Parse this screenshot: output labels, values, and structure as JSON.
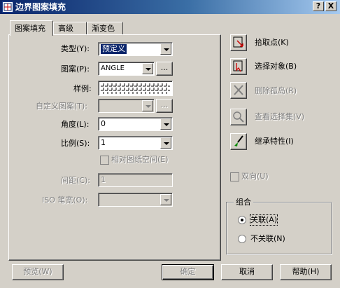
{
  "window": {
    "title": "边界图案填充",
    "help_btn": "?",
    "close_btn": "X"
  },
  "tabs": [
    {
      "label": "图案填充",
      "active": true
    },
    {
      "label": "高级",
      "active": false
    },
    {
      "label": "渐变色",
      "active": false
    }
  ],
  "pattern_tab": {
    "type_label": "类型(Y):",
    "type_value": "预定义",
    "pattern_label": "图案(P):",
    "pattern_value": "ANGLE",
    "pattern_browse": "...",
    "swatch_label": "样例:",
    "custom_label": "自定义图案(T):",
    "custom_value": "",
    "custom_browse": "...",
    "angle_label": "角度(L):",
    "angle_value": "0",
    "scale_label": "比例(S):",
    "scale_value": "1",
    "relative_label": "相对图纸空间(E)",
    "spacing_label": "间距(C):",
    "spacing_value": "1",
    "iso_label": "ISO 笔宽(O):",
    "iso_value": ""
  },
  "side": {
    "pick_points": "拾取点(K)",
    "select_objects": "选择对象(B)",
    "remove_islands": "删除孤岛(R)",
    "view_selections": "查看选择集(V)",
    "inherit": "继承特性(I)",
    "double_label": "双向(U)"
  },
  "composition": {
    "title": "组合",
    "associative": "关联(A)",
    "nonassociative": "不关联(N)",
    "selected": "associative"
  },
  "footer": {
    "preview": "预览(W)",
    "ok": "确定",
    "cancel": "取消",
    "help": "帮助(H)"
  },
  "colors": {
    "title_start": "#0a246a",
    "title_end": "#a6caf0",
    "face": "#d4d0c8",
    "selection": "#0a246a"
  }
}
